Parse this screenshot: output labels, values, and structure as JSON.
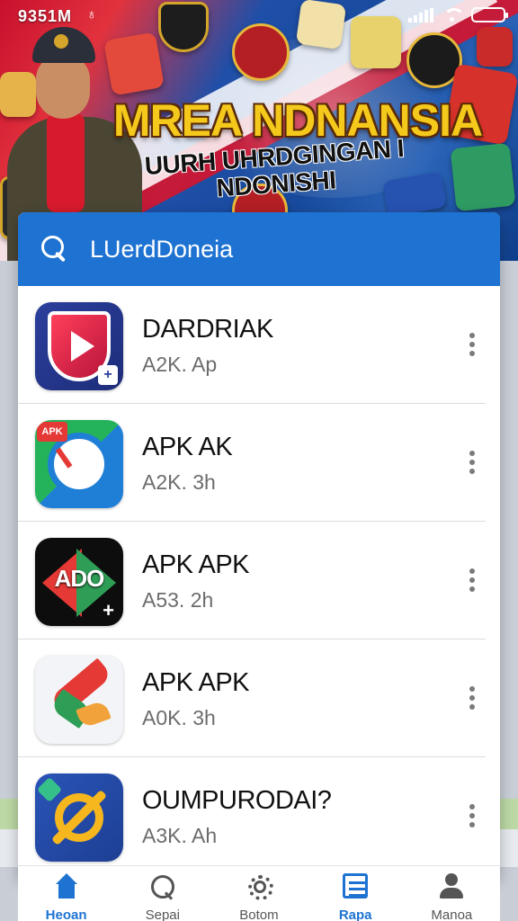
{
  "status_bar": {
    "time": "9351M"
  },
  "banner": {
    "title": "MREA NDNANSIA",
    "subtitle": "UURH UHRDGINGAN I NDONISHI"
  },
  "search": {
    "placeholder": "LUerdDoneia"
  },
  "apps": [
    {
      "name": "DARDRIAK",
      "meta": "A2K. Ap"
    },
    {
      "name": "APK AK",
      "meta": "A2K. 3h"
    },
    {
      "name": "APK APK",
      "meta": "A53. 2h",
      "icon_text": "ADO"
    },
    {
      "name": "APK APK",
      "meta": "A0K. 3h"
    },
    {
      "name": "OUMPURODAI?",
      "meta": "A3K. Ah"
    }
  ],
  "bottom_nav": [
    {
      "label": "Heoan",
      "icon": "home-icon",
      "active": true
    },
    {
      "label": "Sepai",
      "icon": "search-icon",
      "active": false
    },
    {
      "label": "Botom",
      "icon": "gear-icon",
      "active": false
    },
    {
      "label": "Rapa",
      "icon": "list-icon",
      "active": true
    },
    {
      "label": "Manoa",
      "icon": "user-icon",
      "active": false
    }
  ],
  "colors": {
    "primary_blue": "#1e73d2",
    "banner_gold": "#f4c91c",
    "banner_red": "#c8102e"
  }
}
